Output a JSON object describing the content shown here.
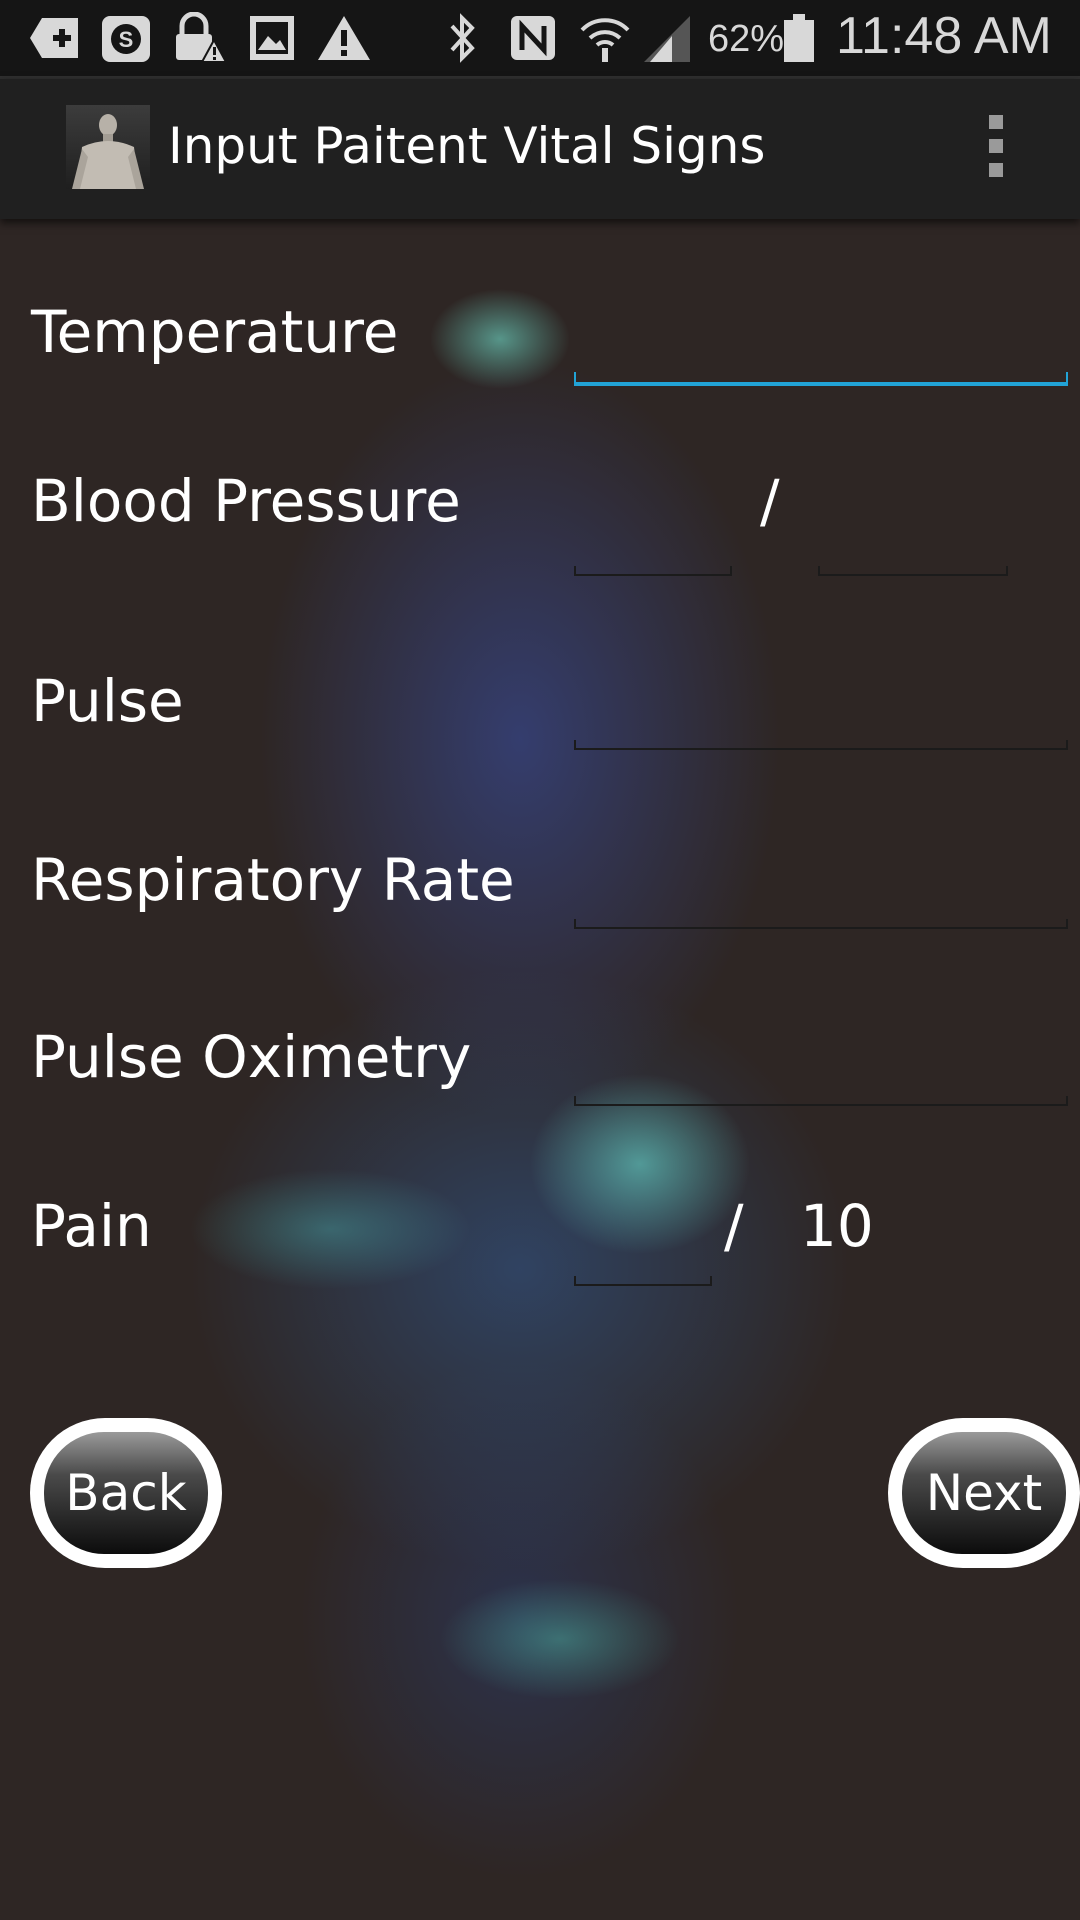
{
  "status_bar": {
    "battery_percent": "62%",
    "time": "11:48 AM",
    "icons": [
      "add-icon",
      "skype-icon",
      "lock-warning-icon",
      "image-icon",
      "warning-icon",
      "bluetooth-icon",
      "nfc-icon",
      "wifi-icon",
      "signal-icon",
      "battery-icon"
    ]
  },
  "action_bar": {
    "title": "Input Paitent Vital Signs",
    "overflow_icon": "overflow-menu-icon"
  },
  "form": {
    "temperature_label": "Temperature",
    "blood_pressure_label": "Blood Pressure",
    "bp_separator": "/",
    "pulse_label": "Pulse",
    "respiratory_rate_label": "Respiratory Rate",
    "pulse_oximetry_label": "Pulse Oximetry",
    "pain_label": "Pain",
    "pain_separator": "/",
    "pain_max": "10"
  },
  "buttons": {
    "back": "Back",
    "next": "Next"
  },
  "colors": {
    "focus_accent": "#22a3d6",
    "background": "#2e2624",
    "action_bar": "#202020"
  }
}
